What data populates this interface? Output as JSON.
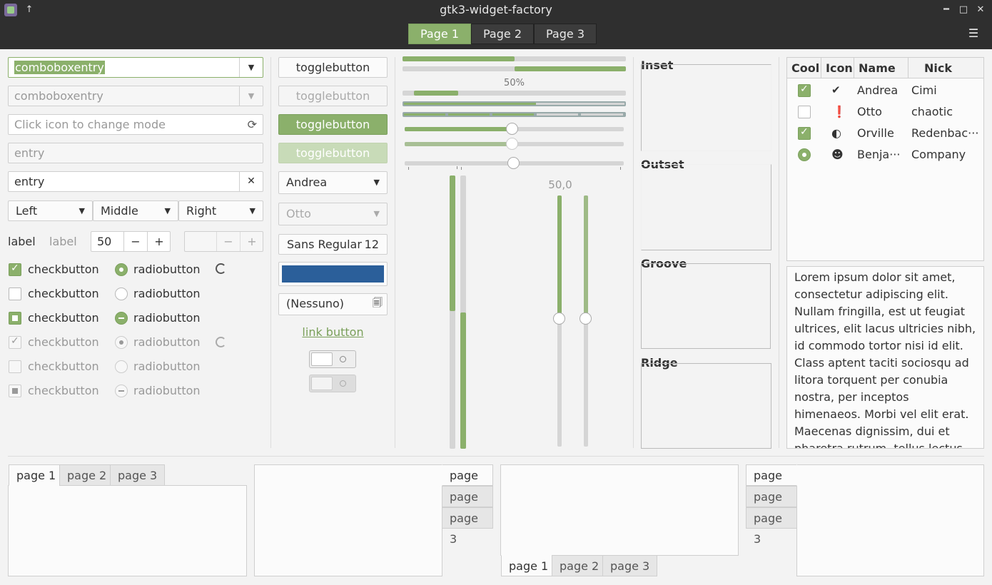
{
  "window": {
    "title": "gtk3-widget-factory"
  },
  "stack_switcher": [
    "Page 1",
    "Page 2",
    "Page 3"
  ],
  "col1": {
    "combo1": "comboboxentry",
    "combo2": "comboboxentry",
    "mode_placeholder": "Click icon to change mode",
    "entry_placeholder": "entry",
    "entry_value": "entry",
    "linked": [
      "Left",
      "Middle",
      "Right"
    ],
    "label1": "label",
    "label2": "label",
    "spin_value": "50",
    "spin_minus": "−",
    "spin_plus": "+",
    "check_label": "checkbutton",
    "radio_label": "radiobutton"
  },
  "col2": {
    "toggle": "togglebutton",
    "combo_andrea": "Andrea",
    "combo_otto": "Otto",
    "font_name": "Sans Regular",
    "font_size": "12",
    "color": "#2b5f9a",
    "file_chooser": "(Nessuno)",
    "link": "link button"
  },
  "col3": {
    "progress_label": "50%",
    "scale_value": "50,0"
  },
  "frames": [
    "Inset",
    "Outset",
    "Groove",
    "Ridge"
  ],
  "tree": {
    "headers": [
      "Cool",
      "Icon",
      "Name",
      "Nick"
    ],
    "rows": [
      {
        "cool": "checked",
        "icon": "check-circle-icon",
        "name": "Andrea",
        "nick": "Cimi"
      },
      {
        "cool": "unchecked",
        "icon": "alert-icon",
        "name": "Otto",
        "nick": "chaotic"
      },
      {
        "cool": "checked",
        "icon": "moon-icon",
        "name": "Orville",
        "nick": "Redenbac···"
      },
      {
        "cool": "radio",
        "icon": "person-icon",
        "name": "Benja···",
        "nick": "Company"
      }
    ]
  },
  "textview": "Lorem ipsum dolor sit amet, consectetur adipiscing elit. Nullam fringilla, est ut feugiat ultrices, elit lacus ultricies nibh, id commodo tortor nisi id elit. Class aptent taciti sociosqu ad litora torquent per conubia nostra, per inceptos himenaeos. Morbi vel elit erat. Maecenas dignissim, dui et pharetra rutrum, tellus lectus rutrum mi, a",
  "notebook_tabs": [
    "page 1",
    "page 2",
    "page 3"
  ],
  "accent_color": "#8bb06b"
}
